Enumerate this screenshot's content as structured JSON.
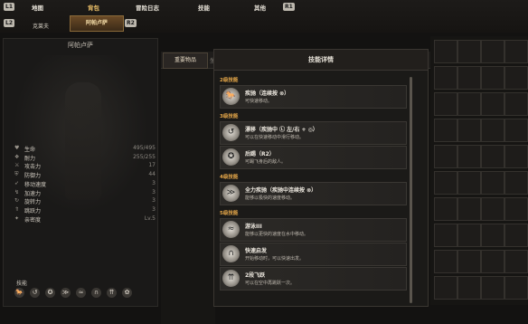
{
  "nav": {
    "left_key": "L1",
    "right_key": "R1",
    "tabs": [
      "地图",
      "背包",
      "冒险日志",
      "技能",
      "其他"
    ],
    "active_tab": "背包"
  },
  "subnav": {
    "left_key": "L2",
    "right_key": "R2",
    "tabs": [
      "克莱夫",
      "阿帕卢萨"
    ],
    "active": "阿帕卢萨"
  },
  "character": {
    "name": "阿帕卢萨",
    "stats": [
      {
        "icon": "heart-icon",
        "glyph": "♥",
        "label": "生命",
        "value": "495/495"
      },
      {
        "icon": "stamina-icon",
        "glyph": "❖",
        "label": "耐力",
        "value": "255/255"
      },
      {
        "icon": "attack-icon",
        "glyph": "⚔",
        "label": "攻击力",
        "value": "17"
      },
      {
        "icon": "defense-icon",
        "glyph": "⛨",
        "label": "防御力",
        "value": "44"
      },
      {
        "icon": "speed-icon",
        "glyph": "➶",
        "label": "移动速度",
        "value": "3"
      },
      {
        "icon": "accel-icon",
        "glyph": "↯",
        "label": "加速力",
        "value": "3"
      },
      {
        "icon": "turn-icon",
        "glyph": "↻",
        "label": "旋转力",
        "value": "3"
      },
      {
        "icon": "jump-icon",
        "glyph": "⇑",
        "label": "跳跃力",
        "value": "3"
      },
      {
        "icon": "affection-icon",
        "glyph": "✦",
        "label": "亲密度",
        "value": "Lv.5"
      }
    ],
    "skills_label": "技能",
    "skill_icons": [
      "gallop-icon",
      "drift-icon",
      "kick-icon",
      "dash-icon",
      "swim-icon",
      "quickstart-icon",
      "double-jump-icon",
      "extra-icon"
    ]
  },
  "item_tabs": {
    "active": "重要物品",
    "second": "坐"
  },
  "modal": {
    "title": "技能详情",
    "sections": [
      {
        "title": "2级技能",
        "skills": [
          {
            "icon": "gallop-icon",
            "glyph": "🐎",
            "name": "疾驰（连续按 ⊗）",
            "desc": "可快速移动。"
          }
        ]
      },
      {
        "title": "3级技能",
        "skills": [
          {
            "icon": "drift-icon",
            "glyph": "↺",
            "name": "漂移（疾驰中 Ⓛ 左/右 + ◎）",
            "desc": "可以在快速移动中滑行移动。"
          },
          {
            "icon": "kick-icon",
            "glyph": "✪",
            "name": "后踢（R2）",
            "desc": "可踢飞身后的敌人。"
          }
        ]
      },
      {
        "title": "4级技能",
        "skills": [
          {
            "icon": "dash-icon",
            "glyph": "≫",
            "name": "全力疾驰（疾驰中连续按 ⊗）",
            "desc": "能够以极快的速度移动。"
          }
        ]
      },
      {
        "title": "5级技能",
        "skills": [
          {
            "icon": "swim-icon",
            "glyph": "≈",
            "name": "游泳III",
            "desc": "能够以更快的速度在水中移动。"
          },
          {
            "icon": "quickstart-icon",
            "glyph": "∩",
            "name": "快速启发",
            "desc": "开始移动时，可以快速出发。"
          },
          {
            "icon": "double-jump-icon",
            "glyph": "⇈",
            "name": "2段飞跃",
            "desc": "可以在空中再跳跃一次。"
          }
        ]
      }
    ]
  }
}
